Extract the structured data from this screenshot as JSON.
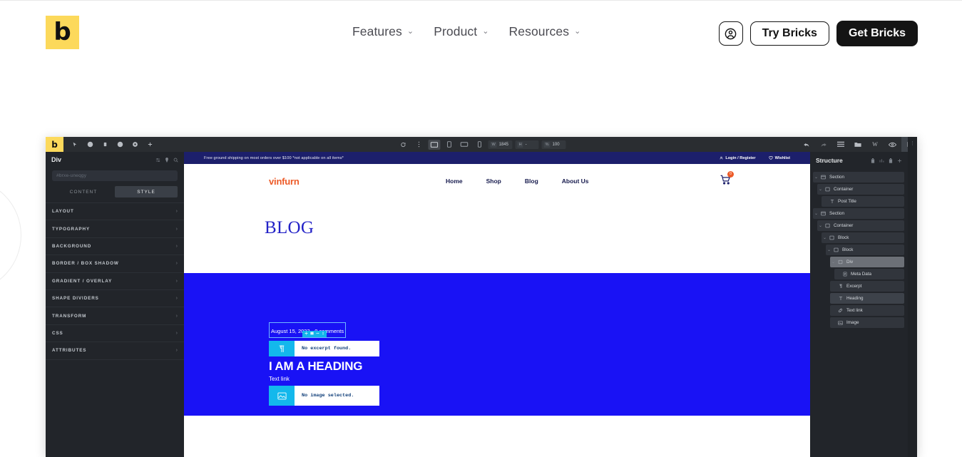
{
  "site_header": {
    "logo_glyph": "b",
    "logo_name": "bricks-logo",
    "nav": [
      {
        "label": "Features",
        "caret": "⌄"
      },
      {
        "label": "Product",
        "caret": "⌄"
      },
      {
        "label": "Resources",
        "caret": "⌄"
      }
    ],
    "account_icon": "account-circle-icon",
    "try_label": "Try Bricks",
    "get_label": "Get Bricks",
    "accent_yellow": "#FCD95B",
    "solid_dark": "#141414"
  },
  "builder": {
    "topbar": {
      "logo_glyph": "b",
      "left_icons": [
        "cursor-icon",
        "help-icon",
        "delete-icon",
        "history-icon",
        "settings-icon",
        "add-icon"
      ],
      "center": {
        "refresh_icon": "refresh-icon",
        "more_icon": "more-vertical-icon",
        "devices": [
          {
            "name": "desktop",
            "active": true
          },
          {
            "name": "tablet-portrait",
            "active": false
          },
          {
            "name": "tablet-landscape",
            "active": false
          },
          {
            "name": "mobile",
            "active": false
          }
        ],
        "width_label": "W",
        "width_value": "1845",
        "height_label": "H",
        "height_value": "-",
        "zoom_label": "%",
        "zoom_value": "100"
      },
      "right_icons": [
        "undo-icon",
        "redo-icon",
        "templates-icon",
        "pages-icon",
        "wordpress-icon",
        "preview-icon",
        "save-icon"
      ]
    },
    "left_panel": {
      "title": "Div",
      "head_icons": [
        "settings-sliders-icon",
        "pin-icon",
        "search-icon"
      ],
      "id_placeholder": "#brxe-uneqgy",
      "tabs": [
        {
          "label": "CONTENT",
          "active": false
        },
        {
          "label": "STYLE",
          "active": true
        }
      ],
      "sections": [
        "LAYOUT",
        "TYPOGRAPHY",
        "BACKGROUND",
        "BORDER / BOX SHADOW",
        "GRADIENT / OVERLAY",
        "SHAPE DIVIDERS",
        "TRANSFORM",
        "CSS",
        "ATTRIBUTES"
      ],
      "section_arrow": "›"
    },
    "canvas": {
      "announcement": "Free ground shipping on most orders over $100 *not applicable on all items*",
      "announcement_links": [
        {
          "label": "Login / Register",
          "icon": "user-icon"
        },
        {
          "label": "Wishlist",
          "icon": "heart-icon"
        }
      ],
      "brand": "vinfurn",
      "nav_links": [
        "Home",
        "Shop",
        "Blog",
        "About Us"
      ],
      "cart_icon": "cart-icon",
      "cart_count": "0",
      "page_title": "BLOG",
      "post": {
        "meta": "August 15, 2023  ·  0 comments",
        "element_toolbar_icons": [
          "move-icon",
          "duplicate-icon",
          "horizontal-resize-icon",
          "vertical-resize-icon"
        ],
        "excerpt_icon": "paragraph-icon",
        "excerpt_placeholder": "No excerpt found.",
        "heading": "I AM A HEADING",
        "text_link": "Text link",
        "image_icon": "image-icon",
        "image_placeholder": "No image selected."
      },
      "colors": {
        "announcement_bg": "#1c1f6b",
        "brand_orange": "#ED5B28",
        "block_blue": "#1912F5",
        "title_blue": "#2322C7",
        "selection_cyan": "#12B5EA"
      }
    },
    "right_panel": {
      "title": "Structure",
      "head_icons": [
        "delete-all-icon",
        "sort-icon",
        "trash-icon",
        "expand-icon"
      ],
      "tree": [
        {
          "label": "Section",
          "depth": 0,
          "icon": "section-icon",
          "caret": "⌄",
          "state": "normal"
        },
        {
          "label": "Container",
          "depth": 1,
          "icon": "container-icon",
          "caret": "⌄",
          "state": "normal"
        },
        {
          "label": "Post Title",
          "depth": 2,
          "icon": "text-icon",
          "caret": "",
          "state": "normal"
        },
        {
          "label": "Section",
          "depth": 0,
          "icon": "section-icon",
          "caret": "⌄",
          "state": "normal"
        },
        {
          "label": "Container",
          "depth": 1,
          "icon": "container-icon",
          "caret": "⌄",
          "state": "normal"
        },
        {
          "label": "Block",
          "depth": 2,
          "icon": "block-icon",
          "caret": "⌄",
          "state": "normal"
        },
        {
          "label": "Block",
          "depth": 3,
          "icon": "block-icon",
          "caret": "⌄",
          "state": "normal"
        },
        {
          "label": "Div",
          "depth": 4,
          "icon": "div-icon",
          "caret": "⌄",
          "state": "selected"
        },
        {
          "label": "Meta Data",
          "depth": 5,
          "icon": "meta-icon",
          "caret": "",
          "state": "normal"
        },
        {
          "label": "Excerpt",
          "depth": 4,
          "icon": "paragraph-icon",
          "caret": "",
          "state": "normal"
        },
        {
          "label": "Heading",
          "depth": 4,
          "icon": "text-icon",
          "caret": "",
          "state": "hover"
        },
        {
          "label": "Text link",
          "depth": 4,
          "icon": "link-icon",
          "caret": "",
          "state": "normal"
        },
        {
          "label": "Image",
          "depth": 4,
          "icon": "image-icon",
          "caret": "",
          "state": "normal"
        }
      ]
    }
  }
}
